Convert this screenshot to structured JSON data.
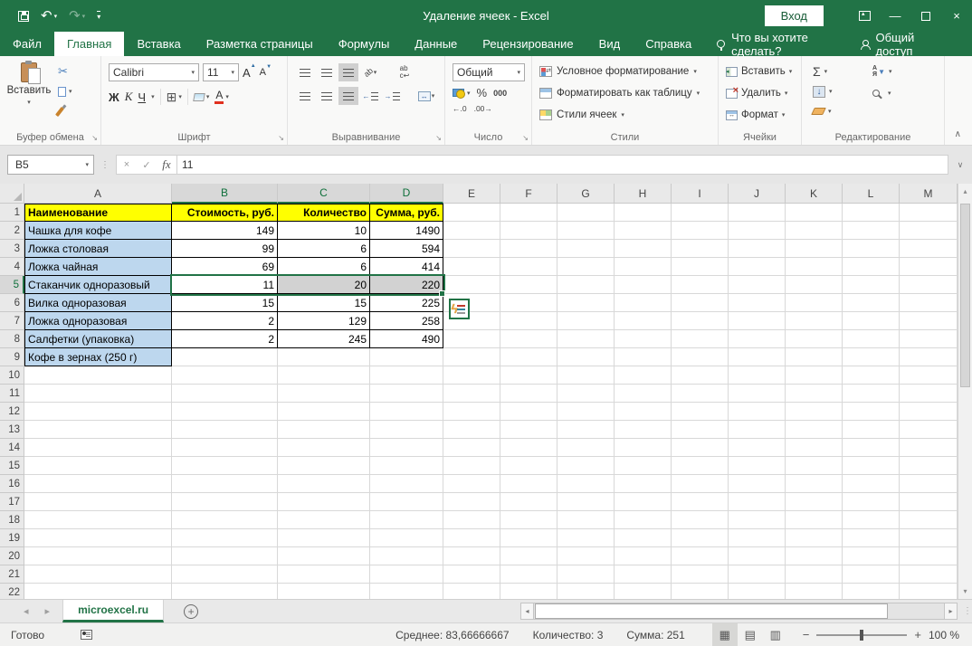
{
  "titlebar": {
    "title": "Удаление ячеек - Excel",
    "signin": "Вход"
  },
  "tabs": {
    "items": [
      "Файл",
      "Главная",
      "Вставка",
      "Разметка страницы",
      "Формулы",
      "Данные",
      "Рецензирование",
      "Вид",
      "Справка"
    ],
    "active": "Главная",
    "search_hint": "Что вы хотите сделать?",
    "share": "Общий доступ"
  },
  "ribbon": {
    "clipboard": {
      "paste": "Вставить",
      "group": "Буфер обмена"
    },
    "font": {
      "name": "Calibri",
      "size": "11",
      "bold": "Ж",
      "italic": "К",
      "underline": "Ч",
      "group": "Шрифт"
    },
    "alignment": {
      "group": "Выравнивание",
      "orientation": "ab",
      "wrap": "ab"
    },
    "number": {
      "format": "Общий",
      "percent": "%",
      "zeros": "000",
      "inc_decimal": "←.0",
      "dec_decimal": ".00→",
      "group": "Число"
    },
    "styles": {
      "conditional": "Условное форматирование",
      "format_table": "Форматировать как таблицу",
      "cell_styles": "Стили ячеек",
      "group": "Стили"
    },
    "cells": {
      "insert": "Вставить",
      "delete": "Удалить",
      "format": "Формат",
      "group": "Ячейки"
    },
    "editing": {
      "sigma": "Σ",
      "sort_a": "А",
      "sort_z": "Я",
      "group": "Редактирование"
    }
  },
  "formula_bar": {
    "name_box": "B5",
    "fx": "fx",
    "value": "11"
  },
  "sheet": {
    "columns": [
      "A",
      "B",
      "C",
      "D",
      "E",
      "F",
      "G",
      "H",
      "I",
      "J",
      "K",
      "L",
      "M"
    ],
    "selected_columns": [
      "B",
      "C",
      "D"
    ],
    "row_count": 22,
    "selected_row": 5,
    "selection": {
      "range": "B5:D5",
      "active_cell": "B5",
      "gray_cells": [
        "C5",
        "D5"
      ]
    },
    "table": {
      "rows": [
        {
          "row": 1,
          "a": "Наименование",
          "b": "Стоимость, руб.",
          "c": "Количество",
          "d": "Сумма, руб.",
          "header": true
        },
        {
          "row": 2,
          "a": "Чашка для кофе",
          "b": "149",
          "c": "10",
          "d": "1490"
        },
        {
          "row": 3,
          "a": "Ложка столовая",
          "b": "99",
          "c": "6",
          "d": "594"
        },
        {
          "row": 4,
          "a": "Ложка чайная",
          "b": "69",
          "c": "6",
          "d": "414"
        },
        {
          "row": 5,
          "a": "Стаканчик одноразовый",
          "b": "11",
          "c": "20",
          "d": "220"
        },
        {
          "row": 6,
          "a": "Вилка одноразовая",
          "b": "15",
          "c": "15",
          "d": "225"
        },
        {
          "row": 7,
          "a": "Ложка одноразовая",
          "b": "2",
          "c": "129",
          "d": "258"
        },
        {
          "row": 8,
          "a": "Салфетки (упаковка)",
          "b": "2",
          "c": "245",
          "d": "490"
        },
        {
          "row": 9,
          "a": "Кофе в зернах (250 г)",
          "b": null,
          "c": null,
          "d": null
        }
      ]
    }
  },
  "sheetbar": {
    "active_tab": "microexcel.ru"
  },
  "statusbar": {
    "ready": "Готово",
    "average": "Среднее: 83,66666667",
    "count": "Количество: 3",
    "sum": "Сумма: 251",
    "zoom": "100 %"
  },
  "colors": {
    "accent_green": "#217346",
    "header_yellow": "#ffff00",
    "name_blue": "#bdd7ee",
    "selection_gray": "#d2d2d2"
  }
}
